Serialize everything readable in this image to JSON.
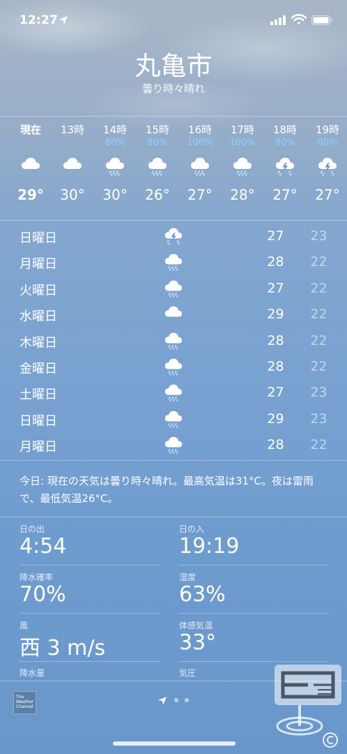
{
  "status_bar": {
    "time": "12:27"
  },
  "header": {
    "city": "丸亀市",
    "condition": "曇り時々晴れ"
  },
  "hourly": [
    {
      "label": "現在",
      "precip": "",
      "icon": "cloud-icon",
      "temp": "29°"
    },
    {
      "label": "13時",
      "precip": "",
      "icon": "cloud-icon",
      "temp": "30°"
    },
    {
      "label": "14時",
      "precip": "80%",
      "icon": "cloud-rain-icon",
      "temp": "30°"
    },
    {
      "label": "15時",
      "precip": "80%",
      "icon": "cloud-rain-icon",
      "temp": "26°"
    },
    {
      "label": "16時",
      "precip": "100%",
      "icon": "cloud-rain-icon",
      "temp": "27°"
    },
    {
      "label": "17時",
      "precip": "100%",
      "icon": "cloud-rain-icon",
      "temp": "28°"
    },
    {
      "label": "18時",
      "precip": "90%",
      "icon": "cloud-bolt-rain-icon",
      "temp": "27°"
    },
    {
      "label": "19時",
      "precip": "60%",
      "icon": "cloud-bolt-rain-icon",
      "temp": "27°"
    }
  ],
  "daily": [
    {
      "day": "日曜日",
      "icon": "cloud-bolt-rain-icon",
      "high": "27",
      "low": "23"
    },
    {
      "day": "月曜日",
      "icon": "cloud-rain-icon",
      "high": "28",
      "low": "22"
    },
    {
      "day": "火曜日",
      "icon": "cloud-rain-icon",
      "high": "27",
      "low": "22"
    },
    {
      "day": "水曜日",
      "icon": "cloud-icon",
      "high": "29",
      "low": "22"
    },
    {
      "day": "木曜日",
      "icon": "cloud-rain-icon",
      "high": "28",
      "low": "22"
    },
    {
      "day": "金曜日",
      "icon": "cloud-rain-icon",
      "high": "28",
      "low": "22"
    },
    {
      "day": "土曜日",
      "icon": "cloud-rain-icon",
      "high": "27",
      "low": "23"
    },
    {
      "day": "日曜日",
      "icon": "cloud-rain-icon",
      "high": "29",
      "low": "23"
    },
    {
      "day": "月曜日",
      "icon": "cloud-rain-icon",
      "high": "28",
      "low": "22"
    }
  ],
  "summary": "今日: 現在の天気は曇り時々晴れ。最高気温は31°C。夜は雷雨で、最低気温26°C。",
  "details": {
    "sunrise_label": "日の出",
    "sunrise": "4:54",
    "sunset_label": "日の入",
    "sunset": "19:19",
    "precip_chance_label": "降水確率",
    "precip_chance": "70%",
    "humidity_label": "湿度",
    "humidity": "63%",
    "wind_label": "風",
    "wind": "西 3 m/s",
    "feels_like_label": "体感気温",
    "feels_like": "33°",
    "precip_amount_label": "降水量",
    "pressure_label": "気圧"
  },
  "footer": {
    "logo_text": "The Weather Channel",
    "page_count": 3,
    "current_page": 0
  },
  "colors": {
    "precip_text": "#8ad4ff",
    "low_temp_text": "rgba(255,255,255,0.55)"
  }
}
